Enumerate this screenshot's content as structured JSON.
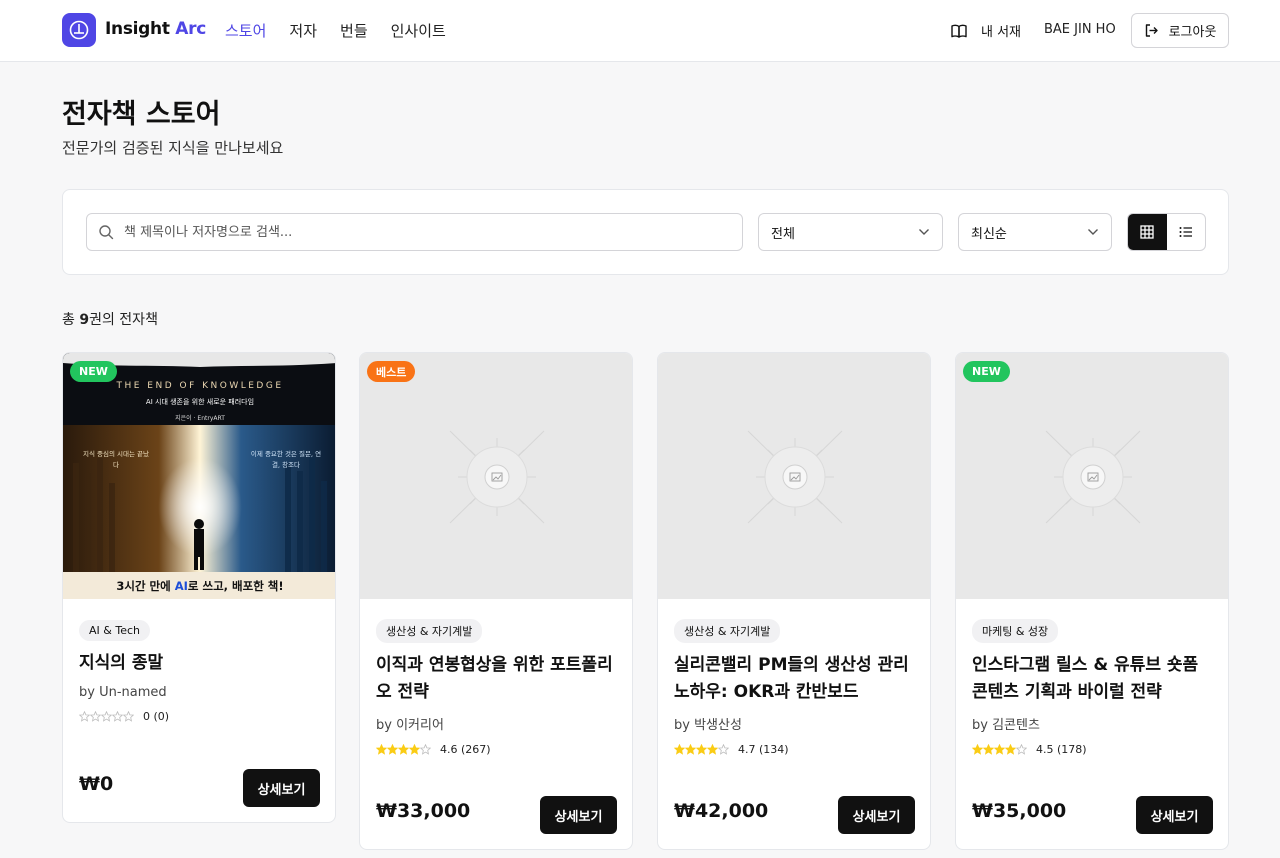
{
  "header": {
    "logo_text_main": "Insight",
    "logo_text_accent": "Arc",
    "nav": [
      {
        "label": "스토어",
        "active": true
      },
      {
        "label": "저자",
        "active": false
      },
      {
        "label": "번들",
        "active": false
      },
      {
        "label": "인사이트",
        "active": false
      }
    ],
    "my_library": "내 서재",
    "username": "BAE JIN HO",
    "logout": "로그아웃"
  },
  "page": {
    "title": "전자책 스토어",
    "subtitle": "전문가의 검증된 지식을 만나보세요"
  },
  "filters": {
    "search_placeholder": "책 제목이나 저자명으로 검색...",
    "search_value": "",
    "category": "전체",
    "sort": "최신순",
    "view_mode": "grid"
  },
  "results": {
    "count_prefix": "총 ",
    "count": "9",
    "count_suffix": "권의 전자책"
  },
  "books": [
    {
      "badge": "NEW",
      "badge_type": "new",
      "category": "AI & Tech",
      "title": "지식의 종말",
      "author": "by Un-named",
      "rating": 0,
      "rating_text": "0 (0)",
      "price": "₩0",
      "button": "상세보기",
      "cover": {
        "headline": "THE END OF KNOWLEDGE",
        "subtitle": "AI 시대 생존을 위한 새로운 패러다임",
        "author_line": "지은이 · EntryART",
        "left_text": "지식 중심의 시대는 끝났다",
        "right_text": "이제 중요한 것은 질문, 연결, 창조다",
        "bottom_pre": "3시간 만에 ",
        "bottom_ai": "AI",
        "bottom_post": "로 쓰고, 배포한 책!"
      }
    },
    {
      "badge": "베스트",
      "badge_type": "best",
      "category": "생산성 & 자기계발",
      "title": "이직과 연봉협상을 위한 포트폴리오 전략",
      "author": "by 이커리어",
      "rating": 4.6,
      "rating_text": "4.6 (267)",
      "price": "₩33,000",
      "button": "상세보기"
    },
    {
      "badge": "",
      "badge_type": "none",
      "category": "생산성 & 자기계발",
      "title": "실리콘밸리 PM들의 생산성 관리 노하우: OKR과 칸반보드",
      "author": "by 박생산성",
      "rating": 4.7,
      "rating_text": "4.7 (134)",
      "price": "₩42,000",
      "button": "상세보기"
    },
    {
      "badge": "NEW",
      "badge_type": "new",
      "category": "마케팅 & 성장",
      "title": "인스타그램 릴스 & 유튜브 숏폼 콘텐츠 기획과 바이럴 전략",
      "author": "by 김콘텐츠",
      "rating": 4.5,
      "rating_text": "4.5 (178)",
      "price": "₩35,000",
      "button": "상세보기"
    }
  ],
  "colors": {
    "accent": "#4f46e5",
    "badge_new": "#22c55e",
    "badge_best": "#f97316",
    "star": "#facc15",
    "button_dark": "#111111"
  }
}
